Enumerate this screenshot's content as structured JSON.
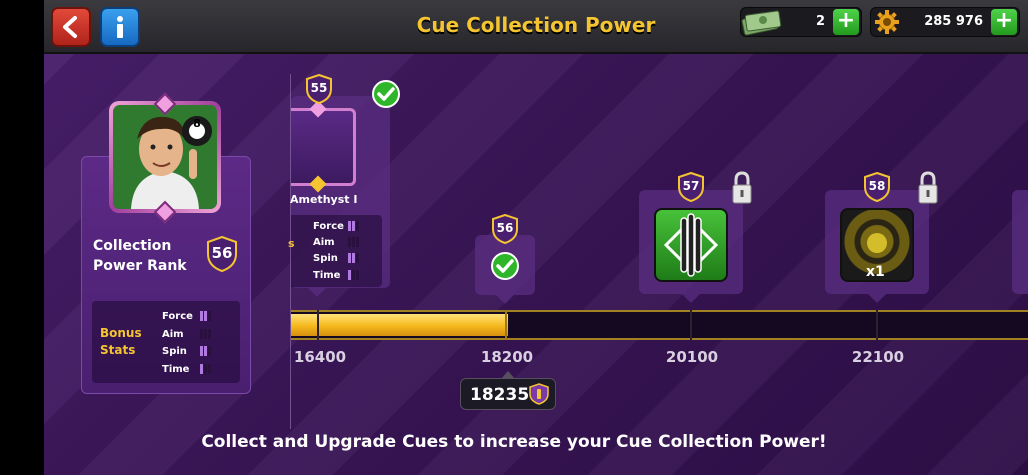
{
  "header": {
    "title": "Cue Collection Power",
    "cash_value": "2",
    "coin_value": "285 976"
  },
  "rank_panel": {
    "label_line1": "Collection",
    "label_line2": "Power Rank",
    "rank": "56",
    "avatar_ball_number": "8",
    "bonus_label_line1": "Bonus",
    "bonus_label_line2": "Stats",
    "stats": [
      {
        "name": "Force",
        "level": 2
      },
      {
        "name": "Aim",
        "level": 0
      },
      {
        "name": "Spin",
        "level": 2
      },
      {
        "name": "Time",
        "level": 1
      }
    ]
  },
  "timeline": {
    "milestones": [
      {
        "value": "16400"
      },
      {
        "value": "18200"
      },
      {
        "value": "20100"
      },
      {
        "value": "22100"
      }
    ],
    "current_progress": "18235",
    "progress_fraction": 0.73
  },
  "cards": {
    "amethyst": {
      "rank": "55",
      "name": "Amethyst I",
      "stats": [
        {
          "name": "Force",
          "level": 2
        },
        {
          "name": "Aim",
          "level": 0
        },
        {
          "name": "Spin",
          "level": 2
        },
        {
          "name": "Time",
          "level": 1
        }
      ],
      "completed": true
    },
    "milestone_56": {
      "rank": "56",
      "completed": true
    },
    "milestone_57": {
      "rank": "57",
      "locked": true,
      "icon": "cue-icon"
    },
    "milestone_58": {
      "rank": "58",
      "locked": true,
      "icon": "target-icon",
      "count": "x1"
    }
  },
  "footer": {
    "text": "Collect and Upgrade Cues to increase your Cue Collection Power!"
  },
  "colors": {
    "accent_gold": "#f5c431",
    "background_purple": "#3b1658",
    "progress_fill": "#f5b81c",
    "confirm_green": "#2fb52a"
  }
}
